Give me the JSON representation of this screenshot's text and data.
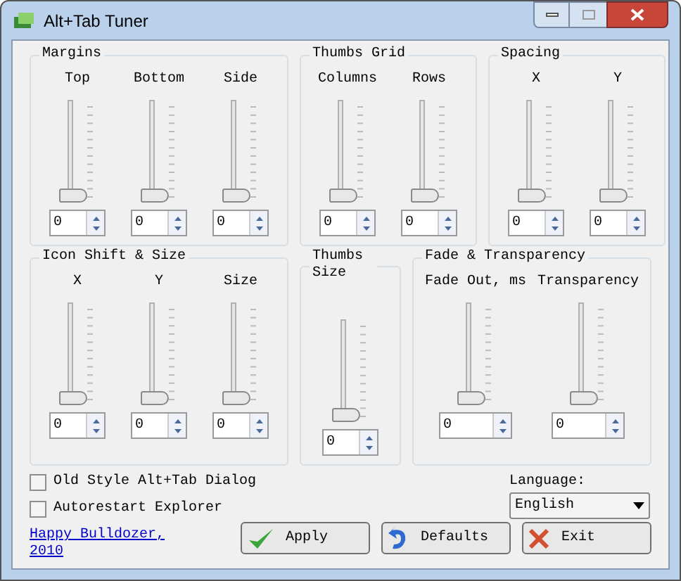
{
  "window": {
    "title": "Alt+Tab Tuner"
  },
  "groups": [
    {
      "title": "Margins",
      "sliders": [
        {
          "label": "Top",
          "level": 0,
          "value": "0"
        },
        {
          "label": "Bottom",
          "level": 0,
          "value": "0"
        },
        {
          "label": "Side",
          "level": 0,
          "value": "0"
        }
      ]
    },
    {
      "title": "Thumbs Grid",
      "sliders": [
        {
          "label": "Columns",
          "level": 0,
          "value": "0"
        },
        {
          "label": "Rows",
          "level": 0,
          "value": "0"
        }
      ]
    },
    {
      "title": "Spacing",
      "sliders": [
        {
          "label": "X",
          "level": 0,
          "value": "0"
        },
        {
          "label": "Y",
          "level": 0,
          "value": "0"
        }
      ]
    },
    {
      "title": "Icon Shift & Size",
      "sliders": [
        {
          "label": "X",
          "level": 0,
          "value": "0"
        },
        {
          "label": "Y",
          "level": 0,
          "value": "0"
        },
        {
          "label": "Size",
          "level": 0,
          "value": "0"
        }
      ]
    },
    {
      "title": "Thumbs Size",
      "sliders": [
        {
          "level": 0,
          "value": "0"
        }
      ]
    },
    {
      "title": "Fade & Transparency",
      "sliders": [
        {
          "label": "Fade Out, ms",
          "level": 0,
          "value": "0"
        },
        {
          "label": "Transparency",
          "level": 0,
          "value": "0"
        }
      ]
    }
  ],
  "options": [
    {
      "label": "Old Style Alt+Tab Dialog",
      "checked": false
    },
    {
      "label": "Autorestart Explorer",
      "checked": false
    }
  ],
  "link": "Happy Bulldozer, 2010",
  "language": {
    "label": "Language:",
    "value": "English"
  },
  "buttons": [
    {
      "kind": "apply",
      "label": "Apply"
    },
    {
      "kind": "defaults",
      "label": "Defaults"
    },
    {
      "kind": "exit",
      "label": "Exit"
    }
  ]
}
